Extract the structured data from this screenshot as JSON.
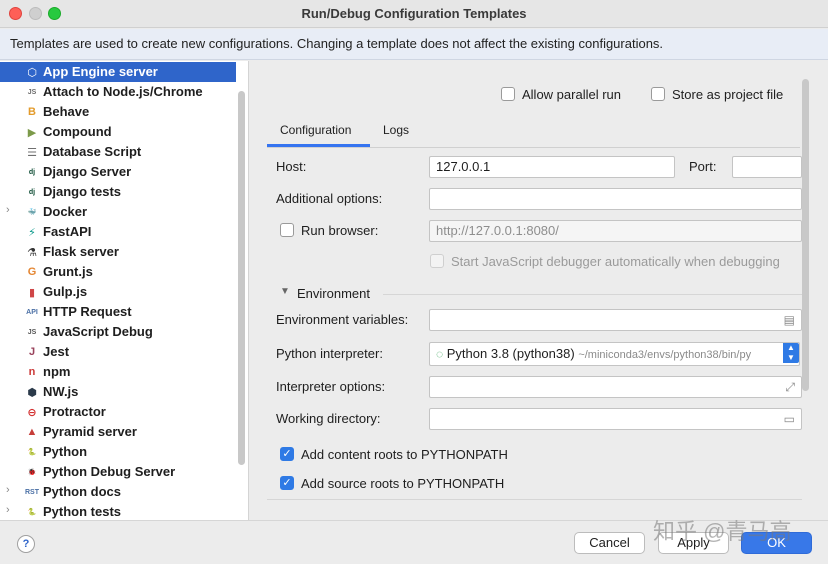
{
  "window": {
    "title": "Run/Debug Configuration Templates",
    "info_text": "Templates are used to create new configurations. Changing a template does not affect the existing configurations."
  },
  "templates": [
    {
      "label": "App Engine server",
      "icon": "app-engine-icon",
      "glyph": "⬡",
      "color": "#4a86e8",
      "selected": true,
      "expandable": false
    },
    {
      "label": "Attach to Node.js/Chrome",
      "icon": "nodejs-icon",
      "glyph": "JS",
      "color": "#6b6b6b",
      "selected": false,
      "expandable": false
    },
    {
      "label": "Behave",
      "icon": "behave-icon",
      "glyph": "B",
      "color": "#e39b2b",
      "selected": false,
      "expandable": false
    },
    {
      "label": "Compound",
      "icon": "compound-icon",
      "glyph": "▶",
      "color": "#7c9a4a",
      "selected": false,
      "expandable": false
    },
    {
      "label": "Database Script",
      "icon": "database-icon",
      "glyph": "☰",
      "color": "#6f6f6f",
      "selected": false,
      "expandable": false
    },
    {
      "label": "Django Server",
      "icon": "django-icon",
      "glyph": "dj",
      "color": "#0c4b33",
      "selected": false,
      "expandable": false
    },
    {
      "label": "Django tests",
      "icon": "django-tests-icon",
      "glyph": "dj",
      "color": "#0c4b33",
      "selected": false,
      "expandable": false
    },
    {
      "label": "Docker",
      "icon": "docker-icon",
      "glyph": "🐳",
      "color": "#2496ed",
      "selected": false,
      "expandable": true
    },
    {
      "label": "FastAPI",
      "icon": "fastapi-icon",
      "glyph": "⚡",
      "color": "#049688",
      "selected": false,
      "expandable": false
    },
    {
      "label": "Flask server",
      "icon": "flask-icon",
      "glyph": "⚗",
      "color": "#333333",
      "selected": false,
      "expandable": false
    },
    {
      "label": "Grunt.js",
      "icon": "grunt-icon",
      "glyph": "G",
      "color": "#e48632",
      "selected": false,
      "expandable": false
    },
    {
      "label": "Gulp.js",
      "icon": "gulp-icon",
      "glyph": "▮",
      "color": "#cf4647",
      "selected": false,
      "expandable": false
    },
    {
      "label": "HTTP Request",
      "icon": "http-request-icon",
      "glyph": "API",
      "color": "#4a6fa5",
      "selected": false,
      "expandable": false
    },
    {
      "label": "JavaScript Debug",
      "icon": "js-debug-icon",
      "glyph": "JS",
      "color": "#555555",
      "selected": false,
      "expandable": false
    },
    {
      "label": "Jest",
      "icon": "jest-icon",
      "glyph": "J",
      "color": "#99425b",
      "selected": false,
      "expandable": false
    },
    {
      "label": "npm",
      "icon": "npm-icon",
      "glyph": "n",
      "color": "#cb3837",
      "selected": false,
      "expandable": false
    },
    {
      "label": "NW.js",
      "icon": "nwjs-icon",
      "glyph": "⬢",
      "color": "#2b3a4a",
      "selected": false,
      "expandable": false
    },
    {
      "label": "Protractor",
      "icon": "protractor-icon",
      "glyph": "⊖",
      "color": "#d32f2f",
      "selected": false,
      "expandable": false
    },
    {
      "label": "Pyramid server",
      "icon": "pyramid-icon",
      "glyph": "▲",
      "color": "#c73e3a",
      "selected": false,
      "expandable": false
    },
    {
      "label": "Python",
      "icon": "python-icon",
      "glyph": "🐍",
      "color": "#3776ab",
      "selected": false,
      "expandable": false
    },
    {
      "label": "Python Debug Server",
      "icon": "python-debug-server-icon",
      "glyph": "🐞",
      "color": "#3776ab",
      "selected": false,
      "expandable": false
    },
    {
      "label": "Python docs",
      "icon": "python-docs-icon",
      "glyph": "RST",
      "color": "#4a6fa5",
      "selected": false,
      "expandable": true
    },
    {
      "label": "Python tests",
      "icon": "python-tests-icon",
      "glyph": "🐍",
      "color": "#3776ab",
      "selected": false,
      "expandable": true
    }
  ],
  "options": {
    "allow_parallel_run": "Allow parallel run",
    "store_as_project_file": "Store as project file"
  },
  "tabs": {
    "configuration": "Configuration",
    "logs": "Logs"
  },
  "form": {
    "host_label": "Host:",
    "host_value": "127.0.0.1",
    "port_label": "Port:",
    "port_value": "",
    "additional_options_label": "Additional options:",
    "additional_options_value": "",
    "run_browser_label": "Run browser:",
    "run_browser_url": "http://127.0.0.1:8080/",
    "js_debugger_label": "Start JavaScript debugger automatically when debugging",
    "environment_section": "Environment",
    "env_vars_label": "Environment variables:",
    "env_vars_value": "",
    "interpreter_label": "Python interpreter:",
    "interpreter_name": "Python 3.8 (python38)",
    "interpreter_path": "~/miniconda3/envs/python38/bin/py",
    "interpreter_options_label": "Interpreter options:",
    "interpreter_options_value": "",
    "working_dir_label": "Working directory:",
    "working_dir_value": "",
    "content_roots_label": "Add content roots to PYTHONPATH",
    "source_roots_label": "Add source roots to PYTHONPATH"
  },
  "buttons": {
    "help": "?",
    "cancel": "Cancel",
    "apply": "Apply",
    "ok": "OK"
  },
  "watermark": "知乎 @青马高"
}
